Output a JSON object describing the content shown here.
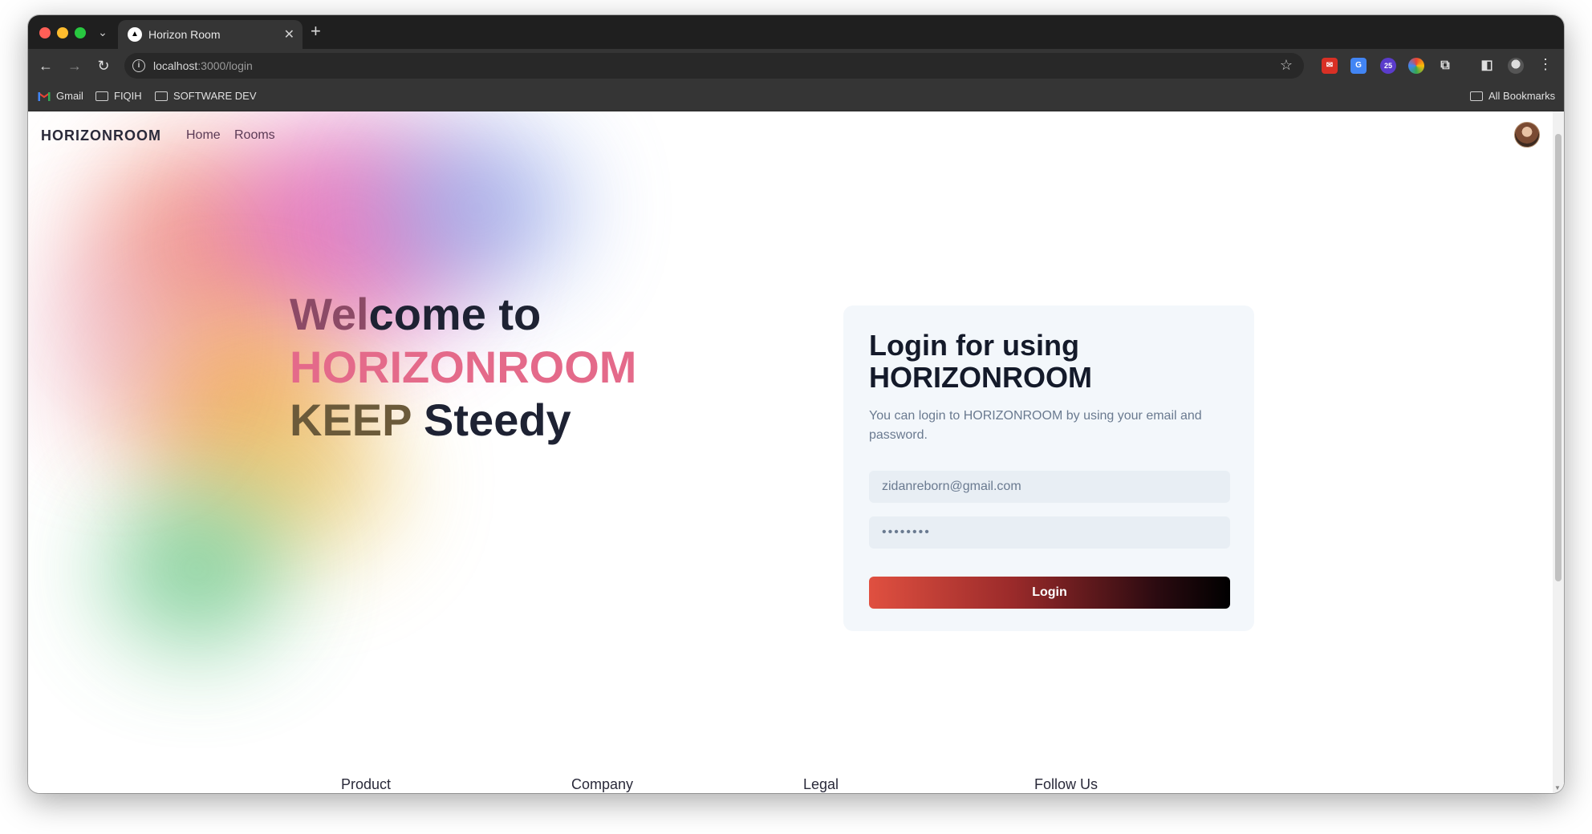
{
  "browser": {
    "tab_title": "Horizon Room",
    "url_host": "localhost",
    "url_path": ":3000/login",
    "extensions": [
      {
        "name": "ext-red-icon",
        "color": "#d93025",
        "label": ""
      },
      {
        "name": "ext-translate-icon",
        "color": "#4285f4",
        "label": "G"
      },
      {
        "name": "ext-badge-icon",
        "color": "#5b3ccc",
        "label": "25"
      },
      {
        "name": "ext-color-icon",
        "color": "#e0e0e0",
        "label": ""
      }
    ],
    "bookmarks": [
      {
        "label": "Gmail",
        "icon": "gmail-icon"
      },
      {
        "label": "FIQIH",
        "icon": "folder-icon"
      },
      {
        "label": "SOFTWARE DEV",
        "icon": "folder-icon"
      }
    ],
    "all_bookmarks_label": "All Bookmarks"
  },
  "nav": {
    "brand": "HORIZONROOM",
    "links": [
      "Home",
      "Rooms"
    ]
  },
  "hero": {
    "line1_a": "Wel",
    "line1_b": "come to",
    "line2": "HORIZONROOM",
    "line3_a": "KEEP",
    "line3_b": " Steedy"
  },
  "login": {
    "title": "Login for using HORIZONROOM",
    "subtitle": "You can login to HORIZONROOM by using your email and password.",
    "email_value": "zidanreborn@gmail.com",
    "password_value": "••••••••",
    "button_label": "Login"
  },
  "footer": {
    "headings": [
      "Product",
      "Company",
      "Legal",
      "Follow Us"
    ]
  }
}
